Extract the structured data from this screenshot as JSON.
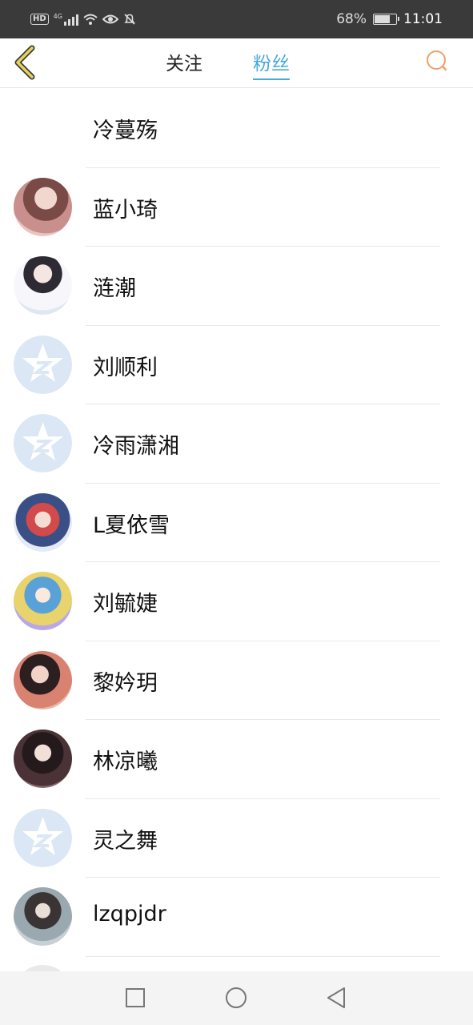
{
  "status_bar": {
    "hd": "HD",
    "network": "4G",
    "battery_percent": "68%",
    "battery_level": 0.68,
    "time": "11:01"
  },
  "nav": {
    "tabs": [
      {
        "label": "关注",
        "active": false
      },
      {
        "label": "粉丝",
        "active": true
      }
    ],
    "accent_color": "#4aaad6",
    "back_icon_color": "#e8d35a",
    "search_icon_color": "#f0a068"
  },
  "fans": [
    {
      "name": "冷蔓殇",
      "avatar": "none"
    },
    {
      "name": "蓝小琦",
      "avatar": "photo"
    },
    {
      "name": "涟潮",
      "avatar": "photo"
    },
    {
      "name": "刘顺利",
      "avatar": "default-qzone-star-icon"
    },
    {
      "name": "冷雨潇湘",
      "avatar": "default-qzone-star-icon"
    },
    {
      "name": "L夏依雪",
      "avatar": "photo"
    },
    {
      "name": "刘毓婕",
      "avatar": "photo"
    },
    {
      "name": "黎妗玥",
      "avatar": "photo"
    },
    {
      "name": "林凉曦",
      "avatar": "photo"
    },
    {
      "name": "灵之舞",
      "avatar": "default-qzone-star-icon"
    },
    {
      "name": "lzqpjdr",
      "avatar": "photo"
    }
  ],
  "system_nav": [
    "recent-apps-icon",
    "home-icon",
    "back-icon"
  ]
}
